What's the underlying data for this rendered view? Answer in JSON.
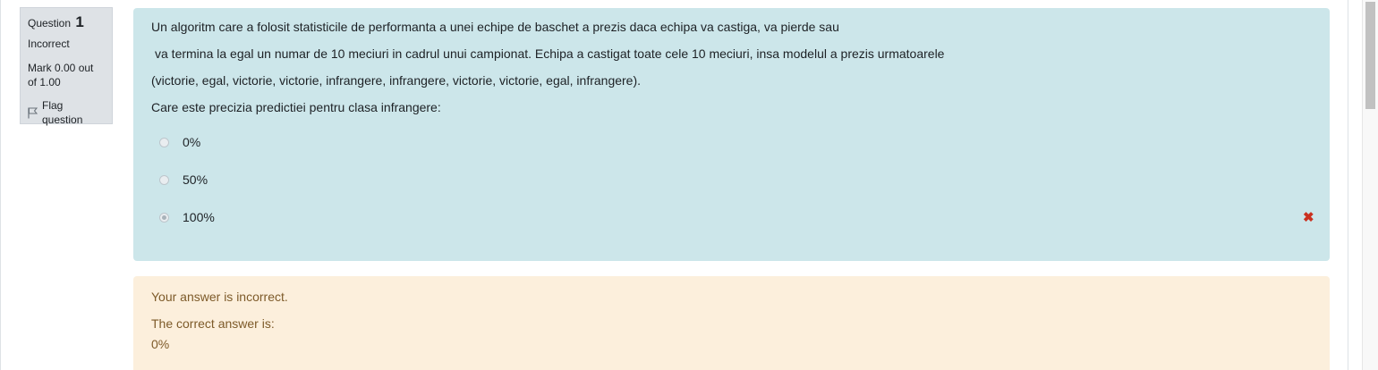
{
  "info": {
    "question_label": "Question",
    "question_number": "1",
    "state": "Incorrect",
    "grade": "Mark 0.00 out of 1.00",
    "flag_label": "Flag question"
  },
  "question": {
    "lines": [
      "Un algoritm care a folosit statisticile de performanta a unei echipe de baschet a prezis daca echipa va castiga, va pierde sau",
      "va termina la egal un numar de 10 meciuri in cadrul unui campionat. Echipa a castigat toate cele 10 meciuri, insa modelul a prezis urmatoarele",
      "(victorie, egal, victorie, victorie, infrangere, infrangere, victorie, victorie, egal, infrangere).",
      "Care este precizia predictiei pentru clasa infrangere:"
    ],
    "options": [
      {
        "label": "0%",
        "checked": false
      },
      {
        "label": "50%",
        "checked": false
      },
      {
        "label": "100%",
        "checked": true
      }
    ],
    "wrong_mark": "✖"
  },
  "feedback": {
    "incorrect": "Your answer is incorrect.",
    "correct_label": "The correct answer is:",
    "correct_value": "0%"
  },
  "colors": {
    "content_bg": "#cce6ea",
    "feedback_bg": "#fcefdc",
    "feedback_text": "#7d5a29",
    "wrong": "#ca3120",
    "info_bg": "#dee2e6"
  }
}
